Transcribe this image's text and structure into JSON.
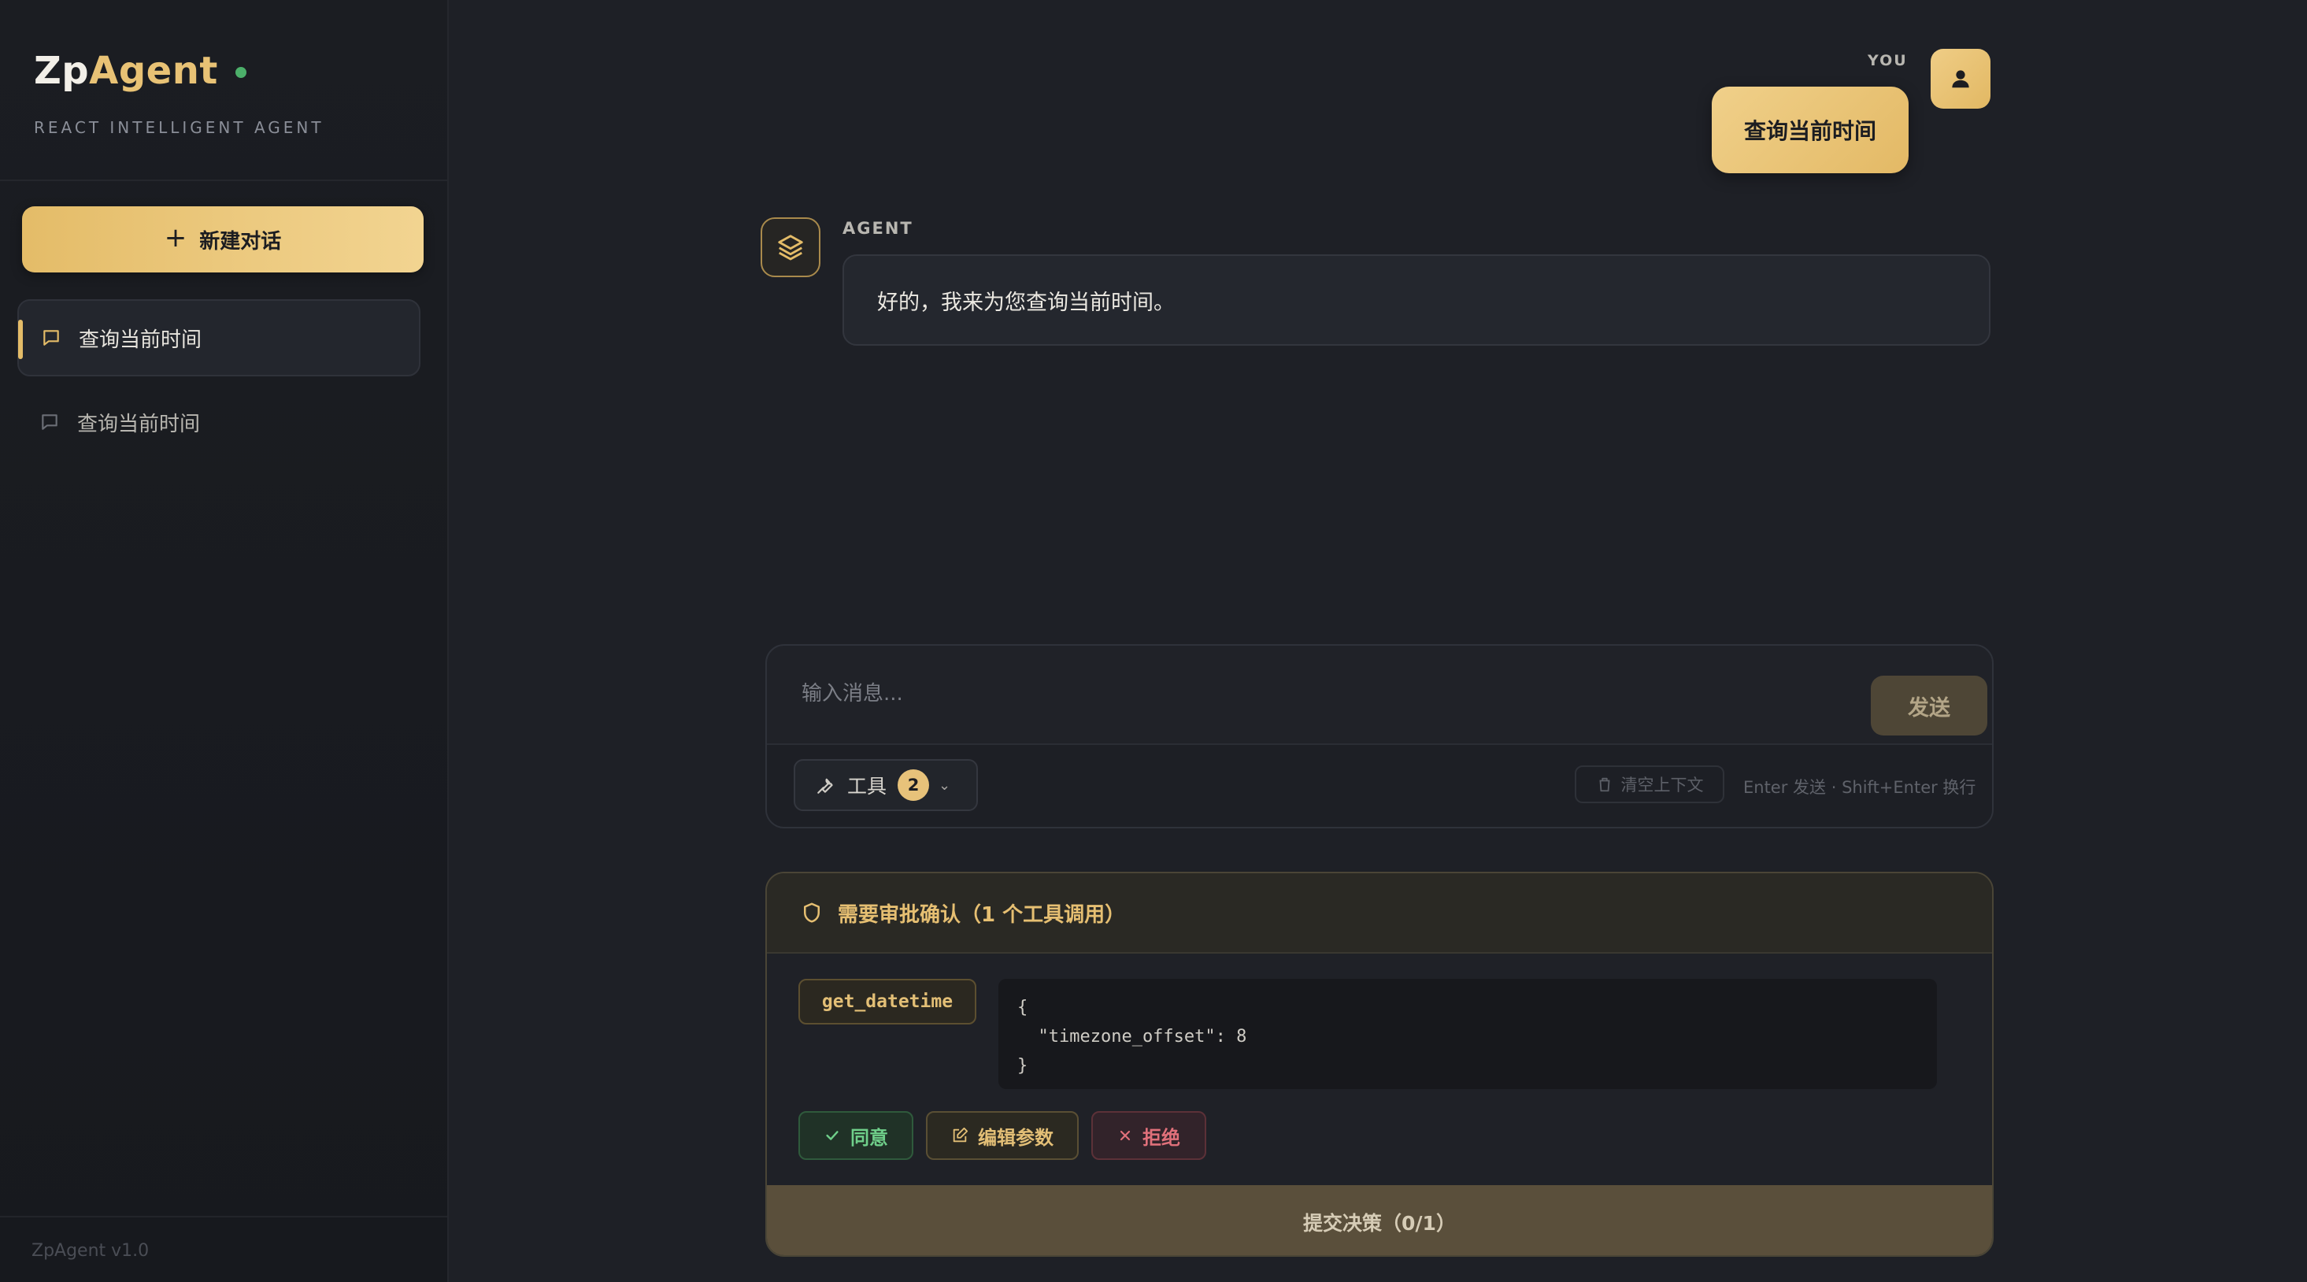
{
  "sidebar": {
    "brand_prefix": "Zp",
    "brand_accent": "Agent",
    "subtitle": "REACT INTELLIGENT AGENT",
    "new_chat_label": "新建对话",
    "conversations": [
      {
        "label": "查询当前时间",
        "active": true
      },
      {
        "label": "查询当前时间",
        "active": false
      }
    ],
    "version": "ZpAgent v1.0"
  },
  "chat": {
    "user_label": "YOU",
    "user_message": "查询当前时间",
    "agent_label": "AGENT",
    "agent_message": "好的，我来为您查询当前时间。"
  },
  "composer": {
    "placeholder": "输入消息...",
    "send_label": "发送",
    "tools_label": "工具",
    "tools_count": "2",
    "clear_label": "清空上下文",
    "hint": "Enter 发送 · Shift+Enter 换行"
  },
  "approval": {
    "title": "需要审批确认（1 个工具调用）",
    "tool_name": "get_datetime",
    "args_line1": "{",
    "args_line2": "  \"timezone_offset\": 8",
    "args_line3": "}",
    "approve_label": "同意",
    "edit_label": "编辑参数",
    "reject_label": "拒绝",
    "submit_label": "提交决策（0/1）"
  },
  "colors": {
    "accent": "#e4bc68",
    "background": "#1e2026",
    "approve": "#6fcf8a",
    "reject": "#e0707a",
    "status_dot": "#4caf6a"
  },
  "icons": [
    "plus-icon",
    "chat-bubble-icon",
    "user-icon",
    "layers-icon",
    "wrench-icon",
    "chevron-down-icon",
    "trash-icon",
    "shield-icon",
    "check-icon",
    "edit-icon",
    "x-icon"
  ]
}
